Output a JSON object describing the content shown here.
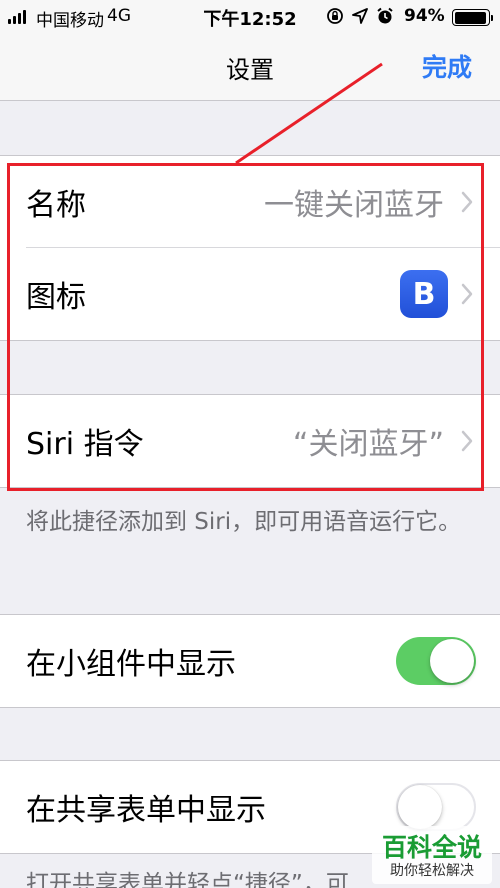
{
  "status_bar": {
    "carrier": "中国移动",
    "network": "4G",
    "time": "下午12:52",
    "battery": "94%",
    "battery_level": 0.94,
    "icons": [
      "signal-icon",
      "rotation-lock-icon",
      "location-icon",
      "alarm-icon",
      "battery-icon"
    ]
  },
  "nav": {
    "title": "设置",
    "done": "完成"
  },
  "details_group": {
    "name_label": "名称",
    "name_value": "一键关闭蓝牙",
    "icon_label": "图标",
    "icon_glyph": "B",
    "icon_color": "#2f5fe6"
  },
  "siri_group": {
    "label": "Siri 指令",
    "value": "“关闭蓝牙”",
    "footnote": "将此捷径添加到 Siri，即可用语音运行它。"
  },
  "widget_group": {
    "label": "在小组件中显示",
    "toggle_on": true
  },
  "share_group": {
    "label": "在共享表单中显示",
    "toggle_on": false,
    "footnote": "打开共享表单并轻点“捷径”，可"
  },
  "annotation": {
    "color": "#e8202a"
  },
  "watermark": {
    "title": "百科全说",
    "subtitle": "助你轻松解决"
  },
  "colors": {
    "accent": "#2f7bf5",
    "toggle_on": "#5ccd64",
    "background": "#efeff4"
  }
}
